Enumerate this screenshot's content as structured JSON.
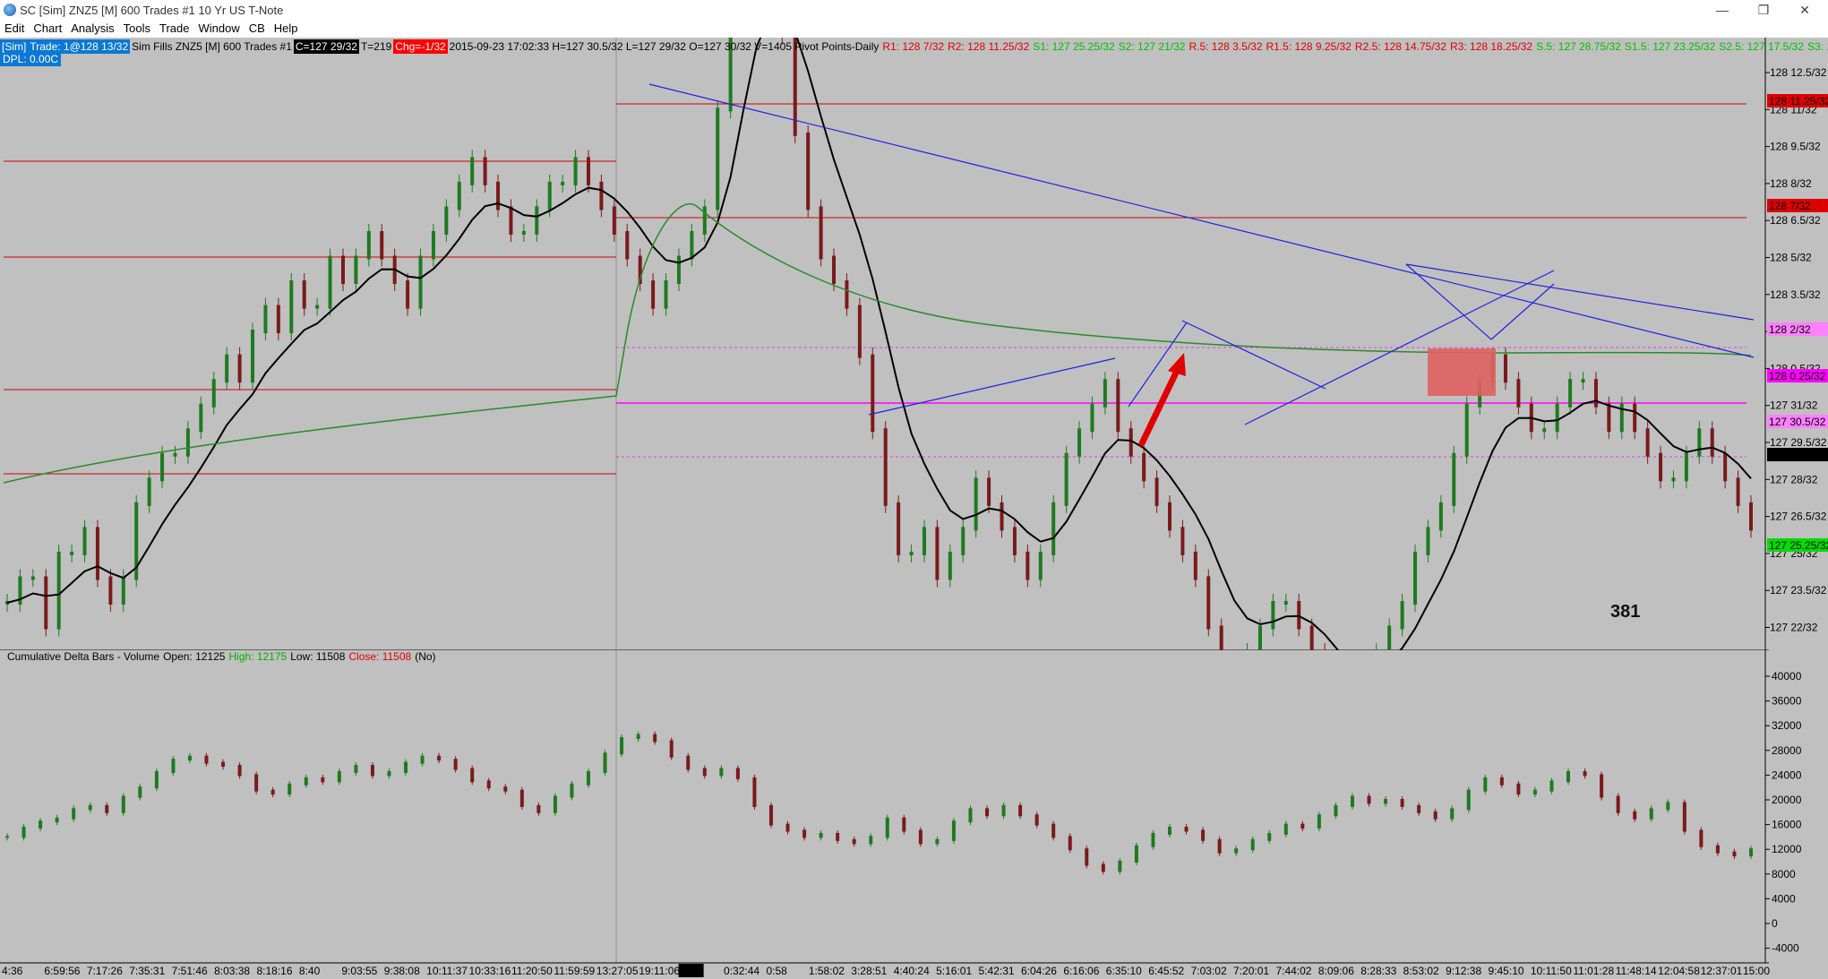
{
  "titlebar": {
    "title": "SC [Sim] ZNZ5 [M]  600 Trades  #1  10 Yr US T-Note",
    "minimize": "—",
    "restore": "❐",
    "close": "✕"
  },
  "menu": [
    "Edit",
    "Chart",
    "Analysis",
    "Tools",
    "Trade",
    "Window",
    "CB",
    "Help"
  ],
  "infobar": {
    "sim": "[Sim]",
    "trade": "Trade: 1@128 13/32",
    "fills": "Sim Fills  ZNZ5 [M]  600 Trades  #1",
    "c": "C=127 29/32",
    "t": "T=219",
    "chg": "Chg=-1/32",
    "stats": "2015-09-23 17:02:33 H=127 30.5/32 L=127 29/32 O=127 30/32 V=1405 Pivot Points-Daily",
    "r1": "R1: 128 7/32",
    "r2": "R2: 128 11.25/32",
    "s1": "S1: 127 25.25/32",
    "s2": "S2: 127 21/32",
    "r05": "R.5: 128 3.5/32",
    "r15": "R1.5: 128 9.25/32",
    "r25": "R2.5: 128 14.75/32",
    "r3": "R3: 128 18.25/32",
    "s05": "S.5: 127 28.75/32",
    "s15": "S1.5: 127 23.25/32",
    "s25": "S2.5: 127 17.5/32",
    "s3": "S3: 127"
  },
  "dpl": "DPL: 0.00C",
  "colors": {
    "background": "#c0c0c0",
    "up_bar": "#1e7a1e",
    "down_bar": "#7a1a1a",
    "pivot_red": "#d40000",
    "pivot_magenta": "#ff00ff",
    "trend_blue": "#2020e0",
    "ma_black": "#000000",
    "ma_green": "#2a8a2a",
    "zone": "#e06060"
  },
  "price_axis": {
    "ticks": [
      "128 12.5/32",
      "128 11/32",
      "128 9.5/32",
      "128 8/32",
      "128 6.5/32",
      "128 5/32",
      "128 3.5/32",
      "128 2/32",
      "128 0.5/32",
      "127 31/32",
      "127 29.5/32",
      "127 28/32",
      "127 26.5/32",
      "127 25/32",
      "127 23.5/32",
      "127 22/32"
    ],
    "markers": [
      {
        "text": "128 11.25/32",
        "bg": "#e00000",
        "fg": "#ffffff"
      },
      {
        "text": "128 7/32",
        "bg": "#e00000",
        "fg": "#ffffff"
      },
      {
        "text": "128 2/32",
        "bg": "#ff80ff",
        "fg": "#ffffff"
      },
      {
        "text": "128 0.25/32",
        "bg": "#ff00ff",
        "fg": "#ffffff"
      },
      {
        "text": "127 30.5/32",
        "bg": "#ff80ff",
        "fg": "#ffffff"
      },
      {
        "text": "127 29/32",
        "bg": "#000000",
        "fg": "#ffffff"
      },
      {
        "text": "127 25.25/32",
        "bg": "#00dd00",
        "fg": "#ffffff"
      }
    ]
  },
  "delta_header": {
    "name": "Cumulative Delta Bars - Volume",
    "open": "Open: 12125",
    "high": "High: 12175",
    "low": "Low: 11508",
    "close": "Close: 11508",
    "flag": "(No)"
  },
  "delta_axis": {
    "ticks": [
      "40000",
      "36000",
      "32000",
      "28000",
      "24000",
      "20000",
      "16000",
      "12000",
      "8000",
      "4000",
      "0",
      "-4000"
    ]
  },
  "time_axis": {
    "labels": [
      "4:36",
      "6:59:56",
      "7:17:26",
      "7:35:31",
      "7:51:46",
      "8:03:38",
      "8:18:16",
      "8:40",
      "9:03:55",
      "9:38:08",
      "10:11:37",
      "10:33:16",
      "11:20:50",
      "11:59:59",
      "13:27:05",
      "19:11:06",
      "9-23",
      "0:32:44",
      "0:58",
      "1:58:02",
      "3:28:51",
      "4:40:24",
      "5:16:01",
      "5:42:31",
      "6:04:26",
      "6:16:06",
      "6:35:10",
      "6:45:52",
      "7:03:02",
      "7:20:01",
      "7:44:02",
      "8:09:06",
      "8:28:33",
      "8:53:02",
      "9:12:38",
      "9:45:10",
      "10:11:50",
      "11:01:28",
      "11:48:14",
      "12:04:58",
      "12:37:01",
      "15:00"
    ]
  },
  "counter": "381",
  "chart_data": {
    "type": "candlestick",
    "price_ylim": [
      127.6875,
      128.40625
    ],
    "price_closes_32nds": [
      10,
      11,
      11,
      9,
      12,
      12,
      13,
      11,
      10,
      11,
      14,
      15,
      16,
      16,
      17,
      18,
      19,
      20,
      19,
      21,
      22,
      21,
      23,
      22,
      22,
      24,
      23,
      24,
      25,
      24,
      23,
      22,
      24,
      25,
      26,
      27,
      28,
      27,
      26,
      25,
      25,
      26,
      27,
      27,
      28,
      27,
      26,
      25,
      24,
      23,
      22,
      23,
      24,
      25,
      26,
      30,
      34,
      40,
      38,
      36,
      33,
      29,
      26,
      24,
      23,
      22,
      20,
      17,
      14,
      12,
      12,
      13,
      11,
      12,
      13,
      15,
      14,
      13,
      12,
      11,
      12,
      14,
      16,
      17,
      18,
      19,
      17,
      16,
      15,
      14,
      13,
      12,
      11,
      9,
      7,
      7,
      8,
      9,
      10,
      10,
      9,
      8,
      7,
      6,
      6,
      7,
      8,
      9,
      10,
      12,
      13,
      14,
      16,
      18,
      19,
      20,
      19,
      18,
      17,
      17,
      18,
      19,
      19,
      18,
      17,
      18,
      17,
      16,
      15,
      15,
      16,
      17,
      16,
      15,
      14,
      13
    ],
    "pivots": {
      "R3": "128 18.25/32",
      "R2.5": "128 14.75/32",
      "R2": "128 11.25/32",
      "R1.5": "128 9.25/32",
      "R1": "128 7/32",
      "R.5": "128 3.5/32",
      "S.5": "127 28.75/32",
      "S1": "127 25.25/32"
    },
    "delta_ylim": [
      -4000,
      40000
    ],
    "delta_values": [
      14000,
      15500,
      16500,
      17000,
      18500,
      19000,
      18000,
      20500,
      22000,
      24500,
      26500,
      27000,
      26000,
      25500,
      24000,
      21500,
      21000,
      22500,
      23500,
      23000,
      24500,
      25500,
      24000,
      24500,
      26000,
      27000,
      26500,
      25000,
      23000,
      22000,
      21500,
      19000,
      18000,
      20500,
      22500,
      24500,
      27500,
      30000,
      30500,
      29500,
      27000,
      25000,
      24000,
      25000,
      23500,
      19000,
      16000,
      15000,
      14000,
      14500,
      13500,
      13000,
      14000,
      17000,
      15000,
      13000,
      13500,
      16500,
      18500,
      17500,
      19000,
      17500,
      16000,
      14000,
      12000,
      9500,
      8500,
      10000,
      12500,
      14500,
      15500,
      15000,
      13500,
      11500,
      12000,
      13500,
      14500,
      16000,
      15500,
      17500,
      19000,
      20500,
      19500,
      20000,
      19000,
      18000,
      17000,
      18500,
      21500,
      23500,
      22500,
      21000,
      21500,
      23000,
      24500,
      24000,
      20500,
      18000,
      17000,
      18500,
      19500,
      15000,
      12500,
      11500,
      11000,
      12000
    ],
    "counter_label": "381"
  }
}
